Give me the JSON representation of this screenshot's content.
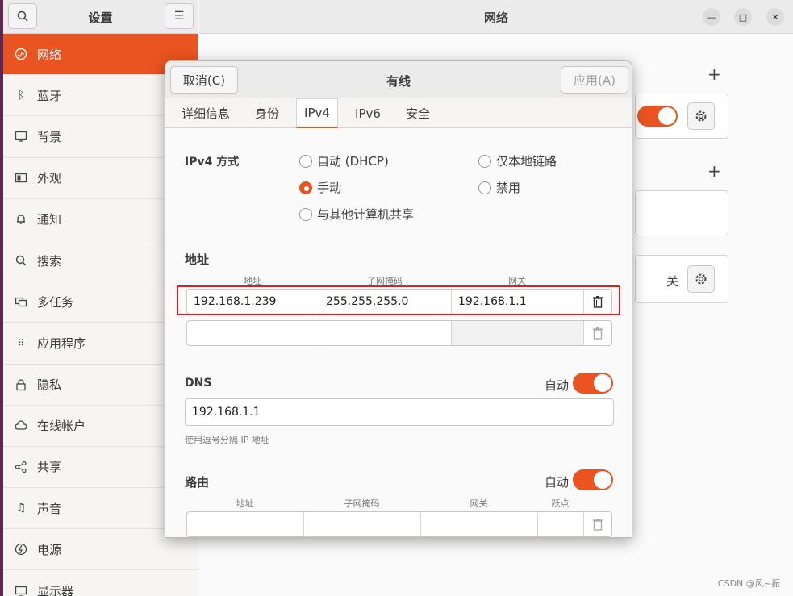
{
  "settings": {
    "title": "设置",
    "sidebar": [
      {
        "label": "网络",
        "icon": "network-icon",
        "active": true
      },
      {
        "label": "蓝牙",
        "icon": "bluetooth-icon"
      },
      {
        "label": "背景",
        "icon": "background-icon"
      },
      {
        "label": "外观",
        "icon": "appearance-icon"
      },
      {
        "label": "通知",
        "icon": "bell-icon"
      },
      {
        "label": "搜索",
        "icon": "search-icon"
      },
      {
        "label": "多任务",
        "icon": "multitask-icon"
      },
      {
        "label": "应用程序",
        "icon": "apps-grid-icon"
      },
      {
        "label": "隐私",
        "icon": "lock-icon"
      },
      {
        "label": "在线帐户",
        "icon": "cloud-icon"
      },
      {
        "label": "共享",
        "icon": "share-icon"
      },
      {
        "label": "声音",
        "icon": "music-note-icon"
      },
      {
        "label": "电源",
        "icon": "power-icon"
      },
      {
        "label": "显示器",
        "icon": "display-icon"
      }
    ]
  },
  "main": {
    "title": "网络",
    "off_label": "关"
  },
  "dialog": {
    "title": "有线",
    "cancel": "取消(C)",
    "apply": "应用(A)",
    "tabs": [
      "详细信息",
      "身份",
      "IPv4",
      "IPv6",
      "安全"
    ],
    "method_label": "IPv4 方式",
    "methods": {
      "auto": "自动 (DHCP)",
      "link_local": "仅本地链路",
      "manual": "手动",
      "disabled": "禁用",
      "shared": "与其他计算机共享"
    },
    "address": {
      "section": "地址",
      "col_address": "地址",
      "col_netmask": "子网掩码",
      "col_gateway": "网关",
      "rows": [
        {
          "address": "192.168.1.239",
          "netmask": "255.255.255.0",
          "gateway": "192.168.1.1"
        }
      ]
    },
    "dns": {
      "section": "DNS",
      "auto_label": "自动",
      "value": "192.168.1.1",
      "hint": "使用逗号分隔 IP 地址"
    },
    "routes": {
      "section": "路由",
      "auto_label": "自动",
      "col_address": "地址",
      "col_netmask": "子网掩码",
      "col_gateway": "网关",
      "col_metric": "跃点"
    }
  },
  "colors": {
    "accent": "#e95420",
    "highlight_box": "#d6212b"
  },
  "watermark": "CSDN @风~振"
}
